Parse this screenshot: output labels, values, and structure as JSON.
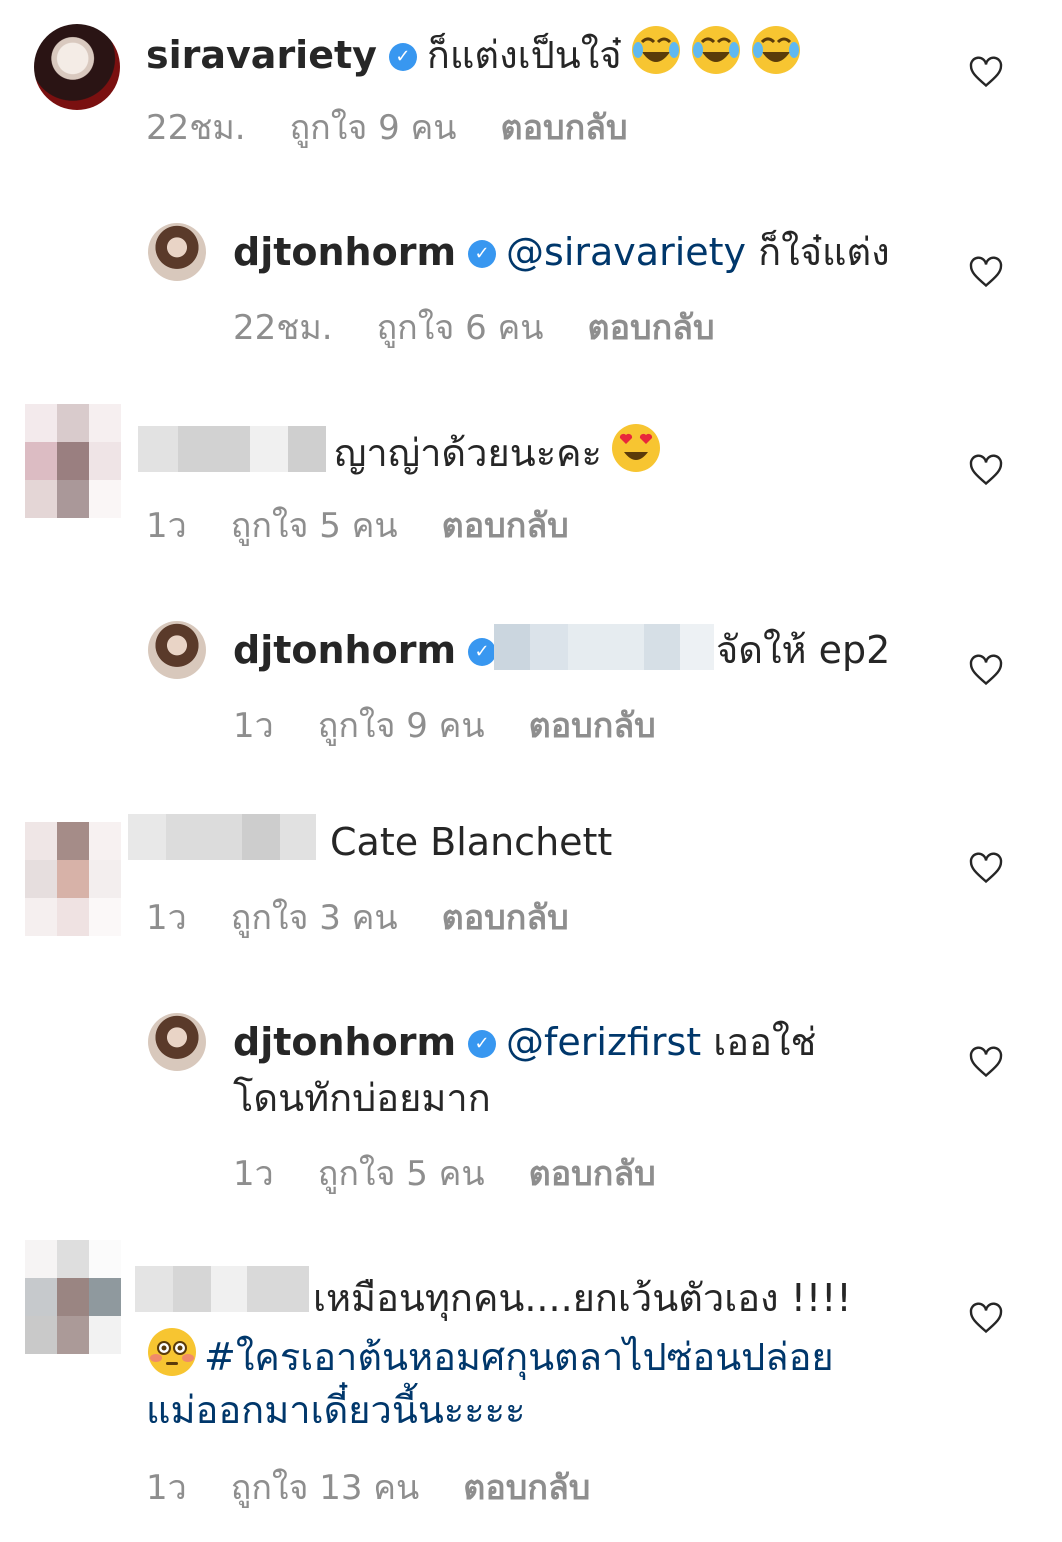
{
  "comments": [
    {
      "user": "siravariety",
      "text": "ก็แต่งเป็นใจ๋",
      "emojis": [
        "face-with-tears-of-joy-icon",
        "face-with-tears-of-joy-icon",
        "face-with-tears-of-joy-icon"
      ],
      "time": "22ชม.",
      "likes": "ถูกใจ 9 คน",
      "reply": "ตอบกลับ"
    },
    {
      "user": "djtonhorm",
      "mention": "@siravariety",
      "text": "ก็ใจ๋แต่ง",
      "time": "22ชม.",
      "likes": "ถูกใจ 6 คน",
      "reply": "ตอบกลับ"
    },
    {
      "text": "ญาญ่าด้วยนะคะ",
      "emojis": [
        "heart-eyes-icon"
      ],
      "time": "1ว",
      "likes": "ถูกใจ 5 คน",
      "reply": "ตอบกลับ"
    },
    {
      "user": "djtonhorm",
      "text": "จัดให้ ep2",
      "time": "1ว",
      "likes": "ถูกใจ 9 คน",
      "reply": "ตอบกลับ"
    },
    {
      "text": "Cate Blanchett",
      "time": "1ว",
      "likes": "ถูกใจ 3 คน",
      "reply": "ตอบกลับ"
    },
    {
      "user": "djtonhorm",
      "mention": "@ferizfirst",
      "text": "เออใช่",
      "text_line2": "โดนทักบ่อยมาก",
      "time": "1ว",
      "likes": "ถูกใจ 5 คน",
      "reply": "ตอบกลับ"
    },
    {
      "text": "เหมือนทุกคน....ยกเว้นตัวเอง !!!!",
      "hashtag_line1": "#ใครเอาต้นหอมศกุนตลาไปซ่อนปล่อย",
      "hashtag_line2": "แม่ออกมาเดี๋ยวนี้นะะะะ",
      "emojis": [
        "flushed-face-icon"
      ],
      "time": "1ว",
      "likes": "ถูกใจ 13 คน",
      "reply": "ตอบกลับ"
    }
  ],
  "colors": {
    "verified": "#3897f0",
    "link": "#00376b",
    "meta": "#8e8e8e"
  }
}
